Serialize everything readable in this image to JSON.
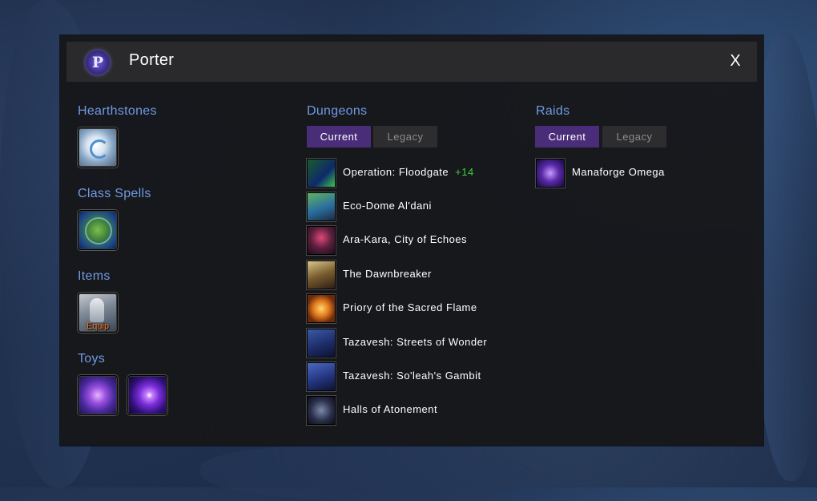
{
  "window": {
    "title": "Porter",
    "close_label": "X",
    "logo_glyph": "P"
  },
  "left": {
    "hearthstones": {
      "title": "Hearthstones",
      "slots": [
        {
          "icon": "hearthstone-icon"
        }
      ]
    },
    "class_spells": {
      "title": "Class Spells",
      "slots": [
        {
          "icon": "teleport-spell-icon"
        }
      ]
    },
    "items": {
      "title": "Items",
      "slots": [
        {
          "icon": "teleport-item-icon",
          "badge": "Equip"
        }
      ]
    },
    "toys": {
      "title": "Toys",
      "slots": [
        {
          "icon": "toy-portal-icon"
        },
        {
          "icon": "toy-vortex-icon"
        }
      ]
    }
  },
  "dungeons": {
    "title": "Dungeons",
    "tabs": [
      {
        "label": "Current",
        "active": true
      },
      {
        "label": "Legacy",
        "active": false
      }
    ],
    "items": [
      {
        "name": "Operation: Floodgate",
        "level": "+14"
      },
      {
        "name": "Eco-Dome Al'dani"
      },
      {
        "name": "Ara-Kara, City of Echoes"
      },
      {
        "name": "The Dawnbreaker"
      },
      {
        "name": "Priory of the Sacred Flame"
      },
      {
        "name": "Tazavesh: Streets of Wonder"
      },
      {
        "name": "Tazavesh: So'leah's Gambit"
      },
      {
        "name": "Halls of Atonement"
      }
    ]
  },
  "raids": {
    "title": "Raids",
    "tabs": [
      {
        "label": "Current",
        "active": true
      },
      {
        "label": "Legacy",
        "active": false
      }
    ],
    "items": [
      {
        "name": "Manaforge Omega"
      }
    ]
  },
  "colors": {
    "section_title": "#6f9ae3",
    "tab_active": "#4a2d79",
    "tab_inactive": "#2d2d2f",
    "keystone_level": "#3ad13a",
    "equip_badge": "#ff7e2e"
  }
}
